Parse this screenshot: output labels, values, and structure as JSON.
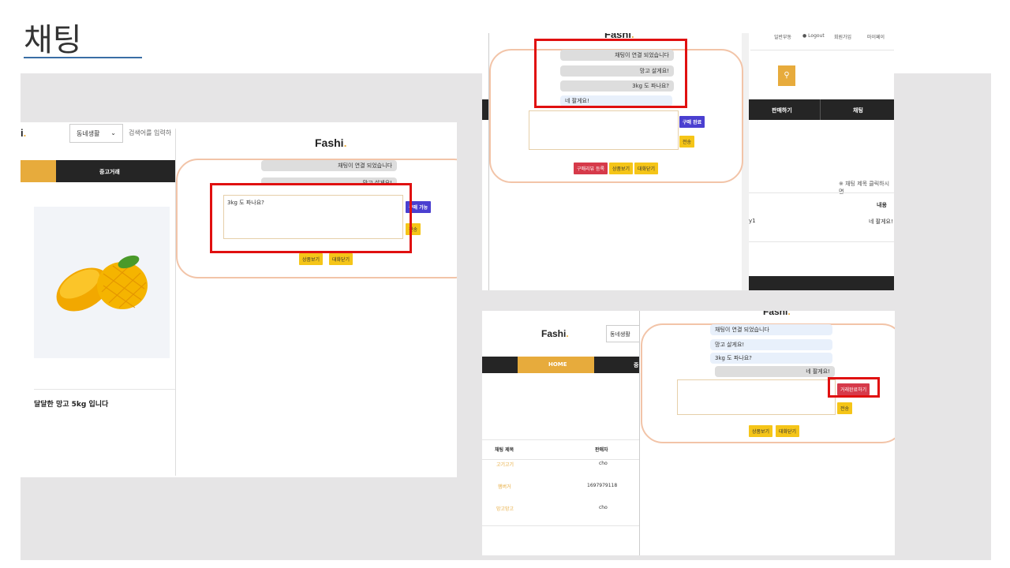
{
  "slide": {
    "title": "채팅"
  },
  "shot1": {
    "logo": "i",
    "logo_dot": ".",
    "select_value": "동네생활",
    "search_placeholder": "검색어를 입력하",
    "nav_item": "중고거래",
    "product_name": "달달한 망고 5kg 입니다",
    "popup": {
      "logo": "Fashi",
      "logo_dot": ".",
      "msg_connected": "채팅이 연결 되었습니다",
      "msg_partial": "망고 살게요!",
      "textarea_value": "3kg 도 파나요?",
      "btn_buy_available": "구매 가능",
      "btn_send": "전송",
      "btn_view_product": "상품보기",
      "btn_close_chat": "대화닫기"
    }
  },
  "shot2": {
    "logo": "Fashi",
    "logo_dot": ".",
    "top_links": [
      "일반부동",
      "Logout",
      "회원가입",
      "마이페이"
    ],
    "nav_sell": "판매하기",
    "nav_chat": "채팅",
    "hint": "※ 채팅 제목 클릭하시면",
    "col_content": "내용",
    "row_suffix": "y1",
    "row_content": "네 팔게요!",
    "popup": {
      "msg_connected": "채팅이 연결 되었습니다",
      "msg_buy": "망고 살게요!",
      "msg_ask": "3kg 도 파나요?",
      "msg_reply": "네 팔게요!",
      "btn_buy_done": "구매 완료",
      "btn_send": "전송",
      "btn_register_buy": "구매리뷰 등록",
      "btn_view_product": "상품보기",
      "btn_close_chat": "대화닫기"
    }
  },
  "shot3": {
    "logo": "Fashi",
    "logo_dot": ".",
    "select_value": "동네생활",
    "nav_home": "HOME",
    "nav_partial": "중",
    "col_title": "채팅 제목",
    "col_seller": "판매자",
    "rows": [
      {
        "title": "고기고기",
        "seller": "cho"
      },
      {
        "title": "햄버거",
        "seller": "1697979118"
      },
      {
        "title": "망고망고",
        "seller": "cho"
      }
    ],
    "popup": {
      "logo": "Fashi",
      "logo_dot": ".",
      "msg_connected": "채팅이 연결 되었습니다",
      "msg_buy": "망고 살게요!",
      "msg_ask": "3kg 도 파나요?",
      "msg_reply": "네 팔게요!",
      "btn_trade_done": "거래완료하기",
      "btn_send": "전송",
      "btn_view_product": "상품보기",
      "btn_close_chat": "대화닫기"
    }
  },
  "colors": {
    "accent": "#e7ab3c",
    "nav": "#252525",
    "highlight": "#e01010"
  }
}
